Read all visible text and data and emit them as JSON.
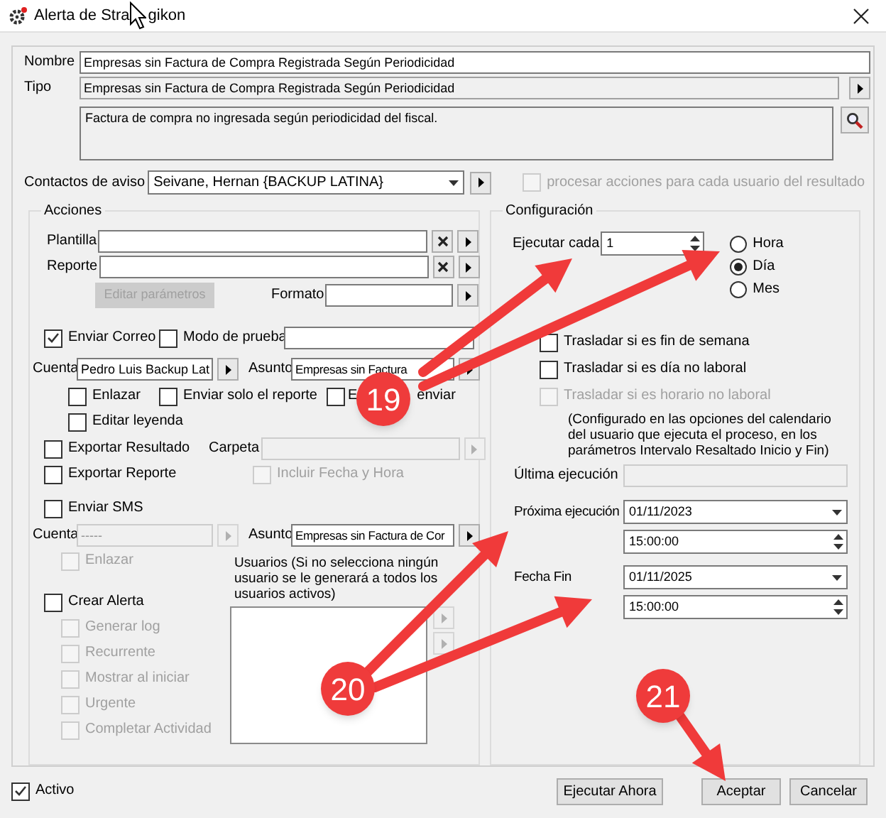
{
  "window": {
    "title_start": "Alerta de Stra",
    "title_end": "gikon"
  },
  "nombre": {
    "label": "Nombre",
    "value": "Empresas sin Factura de Compra Registrada Según Periodicidad"
  },
  "tipo": {
    "label": "Tipo",
    "value": "Empresas sin Factura de Compra Registrada Según Periodicidad",
    "description": "Factura de compra no ingresada según periodicidad del fiscal."
  },
  "contactos": {
    "label": "Contactos de aviso",
    "value": "Seivane, Hernan {BACKUP LATINA}",
    "option": {
      "label": "procesar acciones para cada usuario del resultado",
      "checked": false,
      "disabled": true
    }
  },
  "acciones": {
    "title": "Acciones",
    "plantilla": {
      "label": "Plantilla"
    },
    "reporte": {
      "label": "Reporte"
    },
    "editar_parametros": {
      "label": "Editar parámetros",
      "disabled": true
    },
    "formato": {
      "label": "Formato"
    },
    "enviar_correo": {
      "label": "Enviar Correo",
      "checked": true,
      "disabled": false
    },
    "modo_prueba": {
      "label": "Modo de prueba",
      "checked": false,
      "disabled": false
    },
    "correo_cuenta": {
      "label": "Cuenta",
      "value": "Pedro Luis Backup Lat",
      "disabled": false
    },
    "correo_asunto": {
      "label": "Asunto",
      "value": "Empresas sin Factura",
      "disabled": false
    },
    "correo_options": [
      {
        "label": "Enlazar",
        "checked": false,
        "disabled": false
      },
      {
        "label": "Enviar solo el reporte",
        "checked": false,
        "disabled": false
      },
      {
        "label_start": "E",
        "label_end": "enviar",
        "checked": false,
        "disabled": false
      }
    ],
    "editar_leyenda": {
      "label": "Editar leyenda",
      "checked": false,
      "disabled": false
    },
    "exportar_resultado": {
      "label": "Exportar Resultado",
      "checked": false,
      "disabled": false
    },
    "carpeta": {
      "label": "Carpeta",
      "disabled": true
    },
    "exportar_reporte": {
      "label": "Exportar Reporte",
      "checked": false,
      "disabled": false
    },
    "incluir_fecha": {
      "label": "Incluir Fecha y Hora",
      "checked": false,
      "disabled": true
    },
    "enviar_sms": {
      "label": "Enviar SMS",
      "checked": false,
      "disabled": false
    },
    "sms_cuenta": {
      "label": "Cuenta",
      "value": "-----",
      "disabled": true
    },
    "sms_asunto": {
      "label": "Asunto",
      "value": "Empresas sin Factura de Cor",
      "disabled": false
    },
    "sms_enlazar": {
      "label": "Enlazar",
      "checked": false,
      "disabled": true
    },
    "crear_alerta": {
      "label": "Crear Alerta",
      "checked": false,
      "disabled": false
    },
    "alerta_options": [
      {
        "label": "Generar log",
        "checked": false,
        "disabled": true
      },
      {
        "label": "Recurrente",
        "checked": false,
        "disabled": true
      },
      {
        "label": "Mostrar al iniciar",
        "checked": false,
        "disabled": true
      },
      {
        "label": "Urgente",
        "checked": false,
        "disabled": true
      },
      {
        "label": "Completar Actividad",
        "checked": false,
        "disabled": true
      }
    ],
    "usuarios": {
      "label": "Usuarios (Si no selecciona ningún usuario se le generará a todos los usuarios activos)"
    }
  },
  "configuracion": {
    "title": "Configuración",
    "ejecutar_cada": {
      "label": "Ejecutar cada",
      "value": "1"
    },
    "periodo": [
      {
        "label": "Hora",
        "selected": false
      },
      {
        "label": "Día",
        "selected": true
      },
      {
        "label": "Mes",
        "selected": false
      }
    ],
    "traslados": [
      {
        "label": "Trasladar si es fin de semana",
        "checked": false,
        "disabled": false
      },
      {
        "label": "Trasladar si es día no laboral",
        "checked": false,
        "disabled": false
      },
      {
        "label": "Trasladar si es horario no laboral",
        "checked": false,
        "disabled": true
      }
    ],
    "nota": "(Configurado en las opciones del calendario del usuario que ejecuta el proceso, en los parámetros Intervalo Resaltado Inicio y Fin)",
    "ultima": {
      "label": "Última ejecución"
    },
    "proxima": {
      "label": "Próxima ejecución",
      "date": "01/11/2023",
      "time": "15:00:00"
    },
    "fecha_fin": {
      "label": "Fecha Fin",
      "date": "01/11/2025",
      "time": "15:00:00"
    }
  },
  "activo": {
    "label": "Activo",
    "checked": true,
    "disabled": false
  },
  "buttons": [
    "Ejecutar Ahora",
    "Aceptar",
    "Cancelar"
  ],
  "callouts": [
    "19",
    "20",
    "21"
  ]
}
